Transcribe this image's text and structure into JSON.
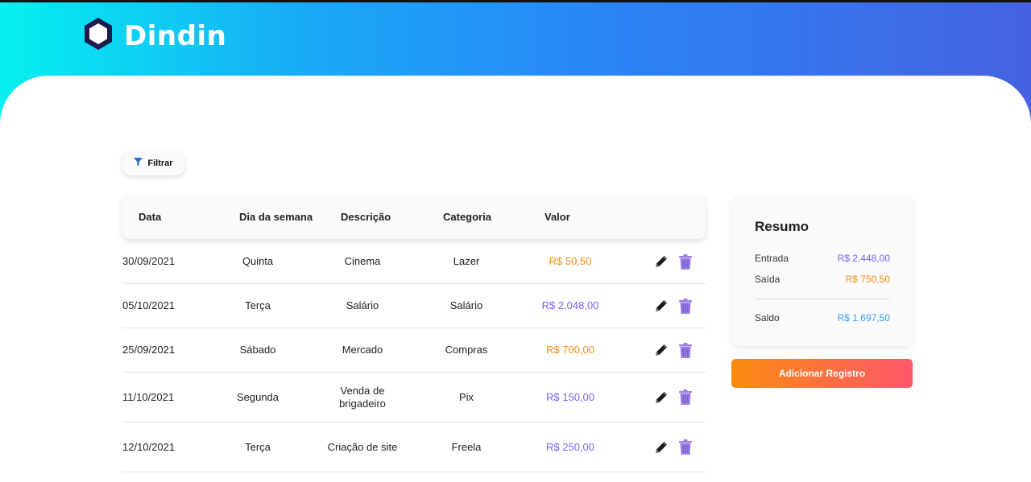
{
  "app": {
    "title": "Dindin",
    "logo_icon": "hexagon-icon"
  },
  "filter": {
    "label": "Filtrar",
    "icon": "filter-icon",
    "icon_color": "#1a6fd4"
  },
  "table": {
    "headers": [
      "Data",
      "Dia da semana",
      "Descrição",
      "Categoria",
      "Valor"
    ],
    "rows": [
      {
        "date": "30/09/2021",
        "weekday": "Quinta",
        "description": "Cinema",
        "category": "Lazer",
        "value": "R$ 50,50",
        "type": "out"
      },
      {
        "date": "05/10/2021",
        "weekday": "Terça",
        "description": "Salário",
        "category": "Salário",
        "value": "R$ 2.048,00",
        "type": "in"
      },
      {
        "date": "25/09/2021",
        "weekday": "Sábado",
        "description": "Mercado",
        "category": "Compras",
        "value": "R$ 700,00",
        "type": "out"
      },
      {
        "date": "11/10/2021",
        "weekday": "Segunda",
        "description": "Venda de brigadeiro",
        "category": "Pix",
        "value": "R$ 150,00",
        "type": "in"
      },
      {
        "date": "12/10/2021",
        "weekday": "Terça",
        "description": "Criação de site",
        "category": "Freela",
        "value": "R$ 250,00",
        "type": "in"
      }
    ],
    "row_actions": {
      "edit_icon": "pencil-icon",
      "delete_icon": "trash-icon"
    }
  },
  "summary": {
    "title": "Resumo",
    "entrada_label": "Entrada",
    "entrada_value": "R$ 2.448,00",
    "saida_label": "Saída",
    "saida_value": "R$ 750,50",
    "saldo_label": "Saldo",
    "saldo_value": "R$ 1.697,50"
  },
  "add_button": {
    "label": "Adicionar Registro"
  },
  "colors": {
    "income": "#7b61ff",
    "expense": "#fa8c10",
    "balance": "#3a9ff1",
    "trash": "#9b7fe6"
  }
}
